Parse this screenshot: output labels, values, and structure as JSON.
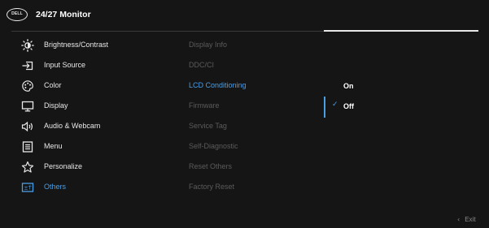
{
  "header": {
    "logo_text": "DELL",
    "title": "24/27 Monitor"
  },
  "menu": {
    "items": [
      {
        "label": "Brightness/Contrast",
        "icon": "brightness-icon"
      },
      {
        "label": "Input Source",
        "icon": "input-source-icon"
      },
      {
        "label": "Color",
        "icon": "color-palette-icon"
      },
      {
        "label": "Display",
        "icon": "display-icon"
      },
      {
        "label": "Audio & Webcam",
        "icon": "audio-icon"
      },
      {
        "label": "Menu",
        "icon": "menu-icon"
      },
      {
        "label": "Personalize",
        "icon": "star-icon"
      },
      {
        "label": "Others",
        "icon": "others-icon"
      }
    ],
    "active": "Others"
  },
  "submenu": {
    "items": [
      {
        "label": "Display Info"
      },
      {
        "label": "DDC/CI"
      },
      {
        "label": "LCD Conditioning"
      },
      {
        "label": "Firmware"
      },
      {
        "label": "Service Tag"
      },
      {
        "label": "Self-Diagnostic"
      },
      {
        "label": "Reset Others"
      },
      {
        "label": "Factory Reset"
      }
    ],
    "active": "LCD Conditioning"
  },
  "options": {
    "items": [
      {
        "label": "On"
      },
      {
        "label": "Off",
        "check": "✓"
      }
    ],
    "selected": "Off"
  },
  "footer": {
    "exit_label": "Exit",
    "exit_chevron": "‹"
  },
  "colors": {
    "accent": "#4a9ee6",
    "background": "#151515",
    "text": "#e8e8e8",
    "disabled_text": "#5b5b5b"
  }
}
